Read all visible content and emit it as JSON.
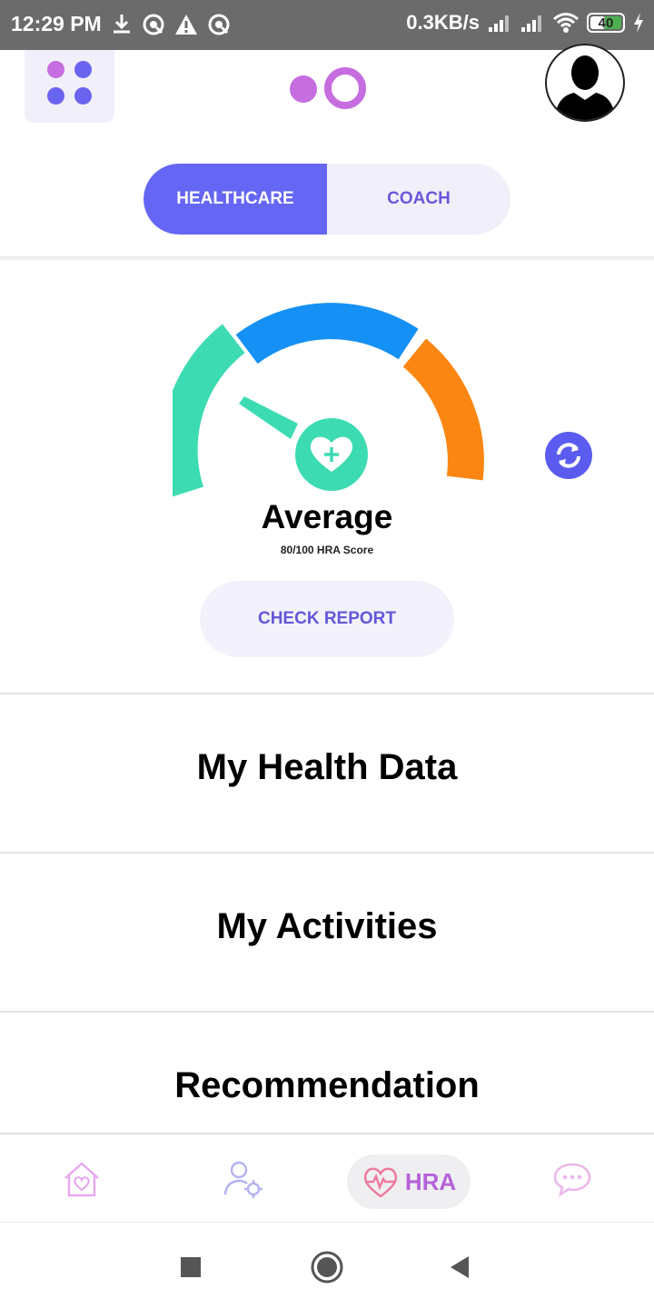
{
  "status_bar": {
    "time": "12:29 PM",
    "speed": "0.3KB/s",
    "battery": "40",
    "icons": [
      "download-icon",
      "sync-icon",
      "alert-icon",
      "sync-icon",
      "signal-icon",
      "signal-icon",
      "wifi-icon",
      "battery-icon",
      "charging-icon"
    ]
  },
  "header": {
    "menu_icon": "grid-dots-icon",
    "logo": "app-logo",
    "avatar": "profile-avatar"
  },
  "tabs": {
    "active": "HEALTHCARE",
    "inactive": "COACH"
  },
  "score": {
    "label": "Average",
    "subtitle": "80/100 HRA Score",
    "value": 80,
    "max": 100,
    "refresh_icon": "refresh-icon",
    "check_report": "CHECK REPORT"
  },
  "sections": {
    "health_data": "My Health Data",
    "activities": "My Activities",
    "recommendation": "Recommendation"
  },
  "bottom_nav": {
    "items": [
      "home-heart-icon",
      "user-settings-icon",
      "heartbeat-icon",
      "chat-icon"
    ],
    "active_label": "HRA"
  },
  "colors": {
    "primary": "#6566f4",
    "accent_purple": "#b562d8",
    "gauge_green": "#3ddbb2",
    "gauge_blue": "#1590f4",
    "gauge_orange": "#fb8712"
  }
}
